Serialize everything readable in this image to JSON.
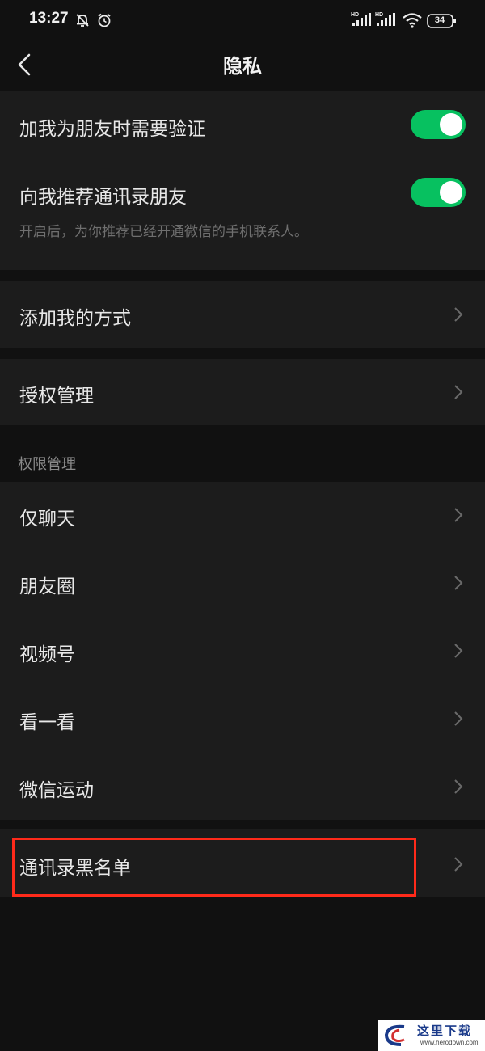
{
  "status_bar": {
    "time": "13:27",
    "battery": "34",
    "icons": [
      "mute-bell-icon",
      "alarm-icon",
      "hd-signal-icon",
      "hd-signal-icon",
      "wifi-icon",
      "battery-icon"
    ]
  },
  "header": {
    "title": "隐私",
    "back_icon": "chevron-left-icon"
  },
  "verification": {
    "add_friend_verify": {
      "label": "加我为朋友时需要验证",
      "enabled": true
    },
    "recommend_contacts": {
      "label": "向我推荐通讯录朋友",
      "enabled": true
    },
    "hint": "开启后，为你推荐已经开通微信的手机联系人。"
  },
  "menu": {
    "add_methods": "添加我的方式",
    "authorization": "授权管理"
  },
  "permissions": {
    "section_title": "权限管理",
    "items": [
      {
        "label": "仅聊天"
      },
      {
        "label": "朋友圈"
      },
      {
        "label": "视频号"
      },
      {
        "label": "看一看"
      },
      {
        "label": "微信运动"
      }
    ]
  },
  "blacklist": {
    "label": "通讯录黑名单"
  },
  "watermark": {
    "text": "这里下载",
    "url": "www.herodown.com"
  },
  "colors": {
    "background": "#111111",
    "card": "#1c1c1c",
    "toggle_on": "#07c160",
    "highlight": "#ff2a1a"
  }
}
